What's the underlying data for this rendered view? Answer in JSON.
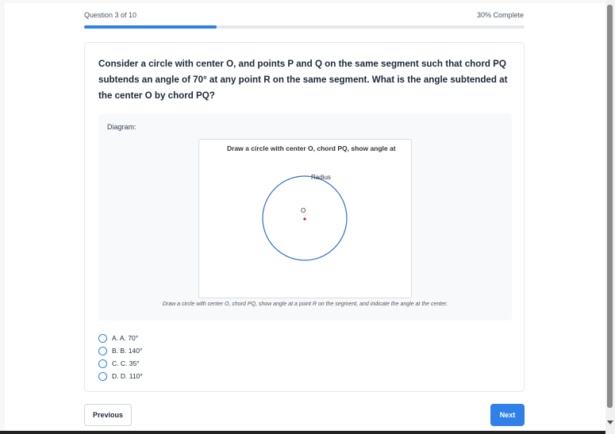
{
  "progress": {
    "question_label": "Question 3 of 10",
    "complete_label": "30% Complete",
    "fraction": 0.3,
    "accent_color": "#2f80e8"
  },
  "question": {
    "text": "Consider a circle with center O, and points P and Q on the same segment such that chord PQ subtends an angle of 70° at any point R on the same segment. What is the angle subtended at the center O by chord PQ?"
  },
  "diagram": {
    "label": "Diagram:",
    "title": "Draw a circle with center O, chord PQ, show angle at",
    "radius_label": "Radius",
    "center_label": "O",
    "caption": "Draw a circle with center O, chord PQ, show angle at a point R on the segment, and indicate the angle at the center.",
    "circle_color": "#2f6fd6",
    "center_dot_color": "#e02020"
  },
  "options": [
    {
      "label": "A. A. 70°"
    },
    {
      "label": "B. B. 140°"
    },
    {
      "label": "C. C. 35°"
    },
    {
      "label": "D. D. 110°"
    }
  ],
  "nav": {
    "previous_label": "Previous",
    "next_label": "Next"
  }
}
